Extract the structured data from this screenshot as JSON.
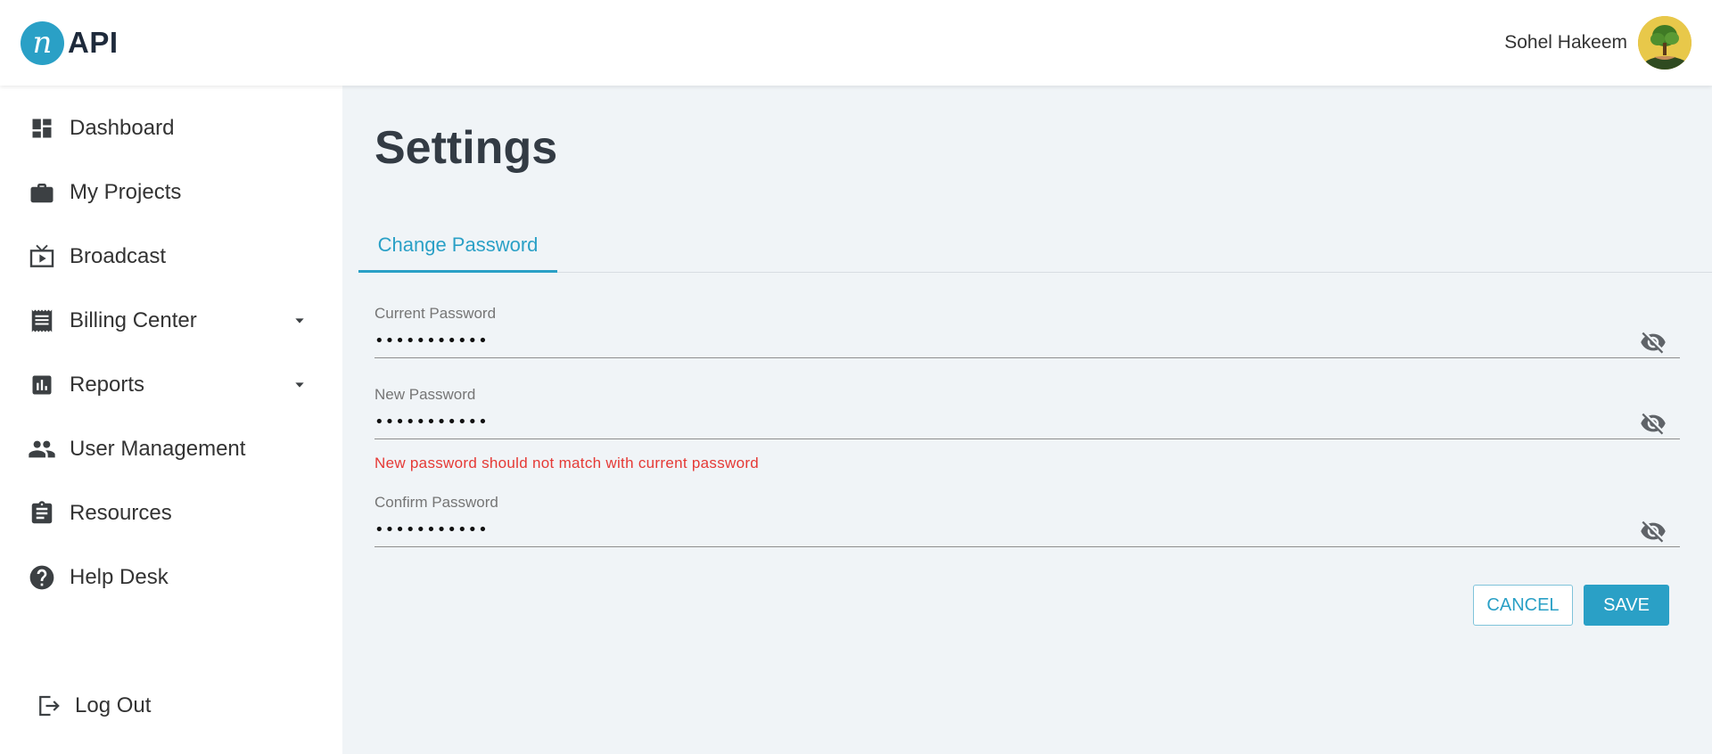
{
  "app": {
    "logo_letter": "n",
    "logo_text": "API",
    "brand_color": "#2aa0c6"
  },
  "user": {
    "name": "Sohel Hakeem"
  },
  "sidebar": {
    "items": [
      {
        "label": "Dashboard",
        "icon": "dashboard-icon"
      },
      {
        "label": "My Projects",
        "icon": "briefcase-icon"
      },
      {
        "label": "Broadcast",
        "icon": "tv-play-icon"
      },
      {
        "label": "Billing Center",
        "icon": "receipt-icon",
        "has_caret": true
      },
      {
        "label": "Reports",
        "icon": "bar-chart-icon",
        "has_caret": true
      },
      {
        "label": "User Management",
        "icon": "people-icon"
      },
      {
        "label": "Resources",
        "icon": "clipboard-icon"
      },
      {
        "label": "Help Desk",
        "icon": "help-circle-icon"
      }
    ],
    "logout": {
      "label": "Log Out",
      "icon": "logout-icon"
    }
  },
  "main": {
    "title": "Settings",
    "tabs": [
      {
        "label": "Change Password",
        "active": true
      }
    ],
    "form": {
      "current_password": {
        "label": "Current Password",
        "value": "•••••••••••"
      },
      "new_password": {
        "label": "New Password",
        "value": "•••••••••••",
        "error": "New password should not match with current password"
      },
      "confirm_password": {
        "label": "Confirm Password",
        "value": "•••••••••••"
      }
    },
    "buttons": {
      "cancel": "CANCEL",
      "save": "SAVE"
    }
  },
  "colors": {
    "error": "#e53935",
    "accent": "#2aa0c6",
    "background": "#f0f4f7"
  }
}
